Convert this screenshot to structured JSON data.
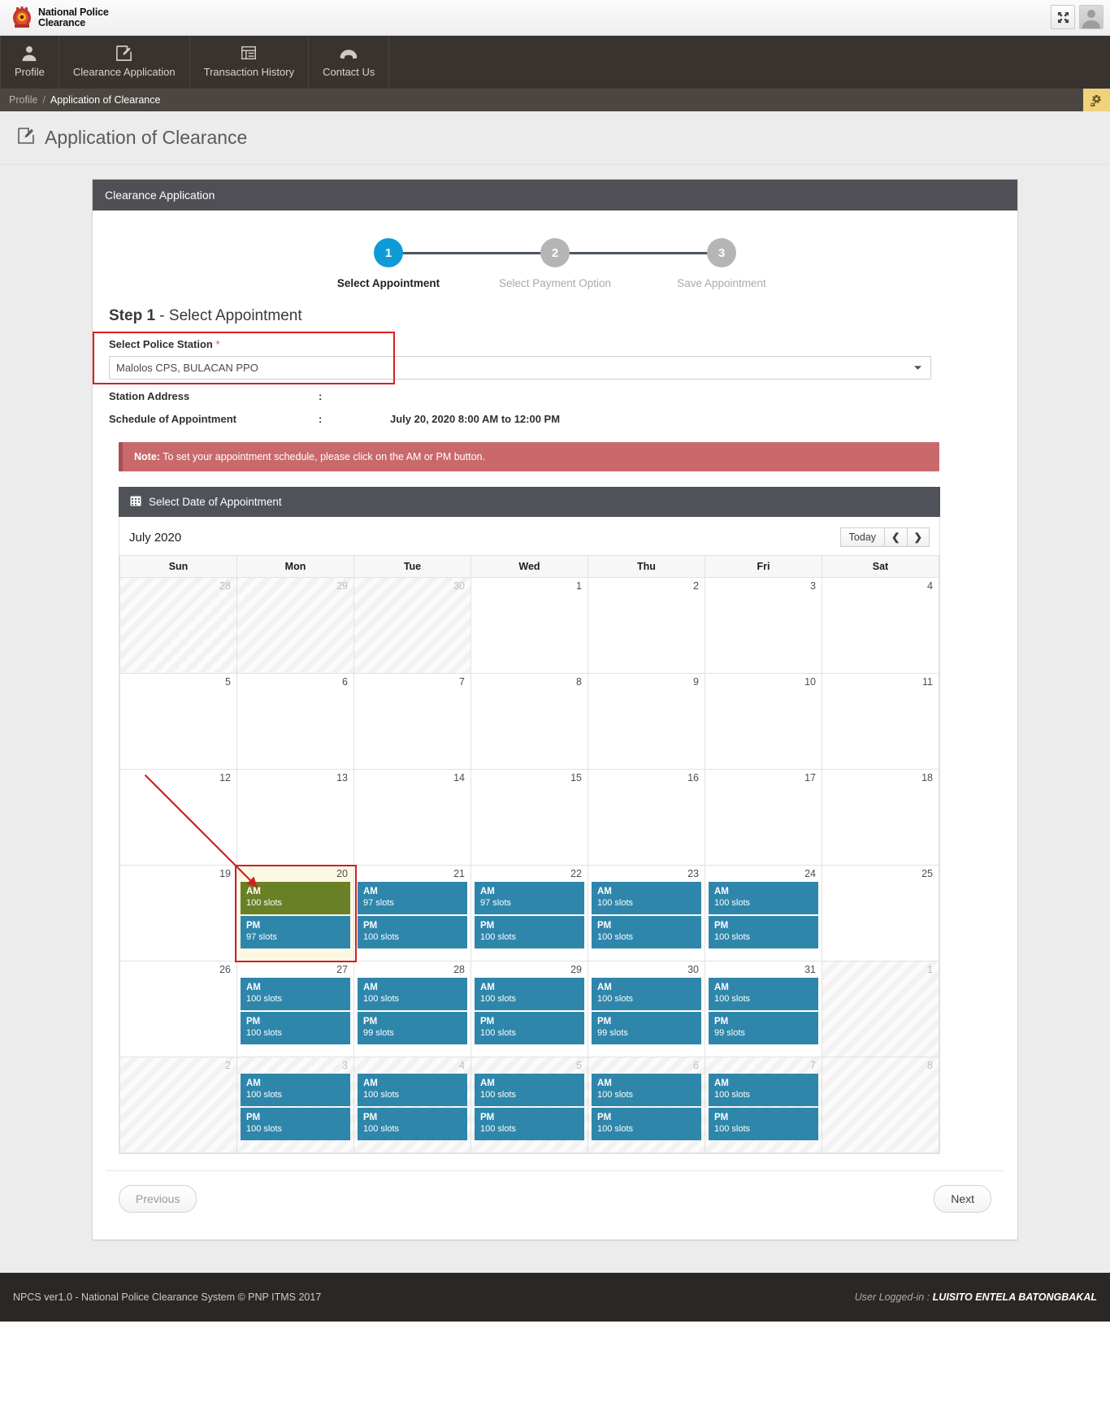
{
  "brand": {
    "line1": "National Police",
    "line2": "Clearance",
    "fullscreen_icon": "expand-icon",
    "avatar_icon": "user-avatar-icon"
  },
  "nav": {
    "items": [
      {
        "label": "Profile",
        "icon": "user-icon"
      },
      {
        "label": "Clearance Application",
        "icon": "edit-document-icon"
      },
      {
        "label": "Transaction History",
        "icon": "list-icon"
      },
      {
        "label": "Contact Us",
        "icon": "phone-icon"
      }
    ]
  },
  "breadcrumb": {
    "parent": "Profile",
    "separator": "/",
    "current": "Application of Clearance",
    "settings_icon": "gears-icon"
  },
  "page": {
    "title": "Application of Clearance",
    "title_icon": "edit-document-icon"
  },
  "panel": {
    "header": "Clearance Application"
  },
  "stepper": {
    "steps": [
      {
        "number": "1",
        "label": "Select Appointment",
        "state": "active"
      },
      {
        "number": "2",
        "label": "Select Payment Option",
        "state": "idle"
      },
      {
        "number": "3",
        "label": "Save Appointment",
        "state": "idle"
      }
    ]
  },
  "step_title": {
    "bold": "Step 1",
    "rest": " - Select Appointment"
  },
  "form": {
    "station_label": "Select Police Station",
    "required_mark": "*",
    "station_value": "Malolos CPS, BULACAN PPO",
    "caret_icon": "chevron-down-icon",
    "station_address_label": "Station Address",
    "station_address_value": "",
    "schedule_label": "Schedule of Appointment",
    "schedule_value": "July 20, 2020 8:00 AM to 12:00 PM",
    "colon": ":"
  },
  "note": {
    "bold": "Note:",
    "text": " To set your appointment schedule, please click on the AM or PM button."
  },
  "calendar": {
    "header": "Select Date of Appointment",
    "header_icon": "calendar-icon",
    "month_label": "July 2020",
    "today_button": "Today",
    "prev_icon": "chevron-left-icon",
    "next_icon": "chevron-right-icon",
    "weekdays": [
      "Sun",
      "Mon",
      "Tue",
      "Wed",
      "Thu",
      "Fri",
      "Sat"
    ],
    "weeks": [
      [
        {
          "day": "28",
          "other": true,
          "slots": []
        },
        {
          "day": "29",
          "other": true,
          "slots": []
        },
        {
          "day": "30",
          "other": true,
          "slots": []
        },
        {
          "day": "1",
          "other": false,
          "slots": []
        },
        {
          "day": "2",
          "other": false,
          "slots": []
        },
        {
          "day": "3",
          "other": false,
          "slots": []
        },
        {
          "day": "4",
          "other": false,
          "slots": []
        }
      ],
      [
        {
          "day": "5",
          "other": false,
          "slots": []
        },
        {
          "day": "6",
          "other": false,
          "slots": []
        },
        {
          "day": "7",
          "other": false,
          "slots": []
        },
        {
          "day": "8",
          "other": false,
          "slots": []
        },
        {
          "day": "9",
          "other": false,
          "slots": []
        },
        {
          "day": "10",
          "other": false,
          "slots": []
        },
        {
          "day": "11",
          "other": false,
          "slots": []
        }
      ],
      [
        {
          "day": "12",
          "other": false,
          "slots": []
        },
        {
          "day": "13",
          "other": false,
          "slots": []
        },
        {
          "day": "14",
          "other": false,
          "slots": []
        },
        {
          "day": "15",
          "other": false,
          "slots": []
        },
        {
          "day": "16",
          "other": false,
          "slots": []
        },
        {
          "day": "17",
          "other": false,
          "slots": []
        },
        {
          "day": "18",
          "other": false,
          "slots": []
        }
      ],
      [
        {
          "day": "19",
          "other": false,
          "slots": []
        },
        {
          "day": "20",
          "other": false,
          "today": true,
          "slots": [
            {
              "period": "AM",
              "count": "100 slots",
              "selected": true
            },
            {
              "period": "PM",
              "count": "97 slots",
              "selected": false
            }
          ]
        },
        {
          "day": "21",
          "other": false,
          "slots": [
            {
              "period": "AM",
              "count": "97 slots",
              "selected": false
            },
            {
              "period": "PM",
              "count": "100 slots",
              "selected": false
            }
          ]
        },
        {
          "day": "22",
          "other": false,
          "slots": [
            {
              "period": "AM",
              "count": "97 slots",
              "selected": false
            },
            {
              "period": "PM",
              "count": "100 slots",
              "selected": false
            }
          ]
        },
        {
          "day": "23",
          "other": false,
          "slots": [
            {
              "period": "AM",
              "count": "100 slots",
              "selected": false
            },
            {
              "period": "PM",
              "count": "100 slots",
              "selected": false
            }
          ]
        },
        {
          "day": "24",
          "other": false,
          "slots": [
            {
              "period": "AM",
              "count": "100 slots",
              "selected": false
            },
            {
              "period": "PM",
              "count": "100 slots",
              "selected": false
            }
          ]
        },
        {
          "day": "25",
          "other": false,
          "slots": []
        }
      ],
      [
        {
          "day": "26",
          "other": false,
          "slots": []
        },
        {
          "day": "27",
          "other": false,
          "slots": [
            {
              "period": "AM",
              "count": "100 slots",
              "selected": false
            },
            {
              "period": "PM",
              "count": "100 slots",
              "selected": false
            }
          ]
        },
        {
          "day": "28",
          "other": false,
          "slots": [
            {
              "period": "AM",
              "count": "100 slots",
              "selected": false
            },
            {
              "period": "PM",
              "count": "99 slots",
              "selected": false
            }
          ]
        },
        {
          "day": "29",
          "other": false,
          "slots": [
            {
              "period": "AM",
              "count": "100 slots",
              "selected": false
            },
            {
              "period": "PM",
              "count": "100 slots",
              "selected": false
            }
          ]
        },
        {
          "day": "30",
          "other": false,
          "slots": [
            {
              "period": "AM",
              "count": "100 slots",
              "selected": false
            },
            {
              "period": "PM",
              "count": "99 slots",
              "selected": false
            }
          ]
        },
        {
          "day": "31",
          "other": false,
          "slots": [
            {
              "period": "AM",
              "count": "100 slots",
              "selected": false
            },
            {
              "period": "PM",
              "count": "99 slots",
              "selected": false
            }
          ]
        },
        {
          "day": "1",
          "other": true,
          "slots": []
        }
      ],
      [
        {
          "day": "2",
          "other": true,
          "slots": []
        },
        {
          "day": "3",
          "other": true,
          "slots": [
            {
              "period": "AM",
              "count": "100 slots",
              "selected": false
            },
            {
              "period": "PM",
              "count": "100 slots",
              "selected": false
            }
          ]
        },
        {
          "day": "4",
          "other": true,
          "slots": [
            {
              "period": "AM",
              "count": "100 slots",
              "selected": false
            },
            {
              "period": "PM",
              "count": "100 slots",
              "selected": false
            }
          ]
        },
        {
          "day": "5",
          "other": true,
          "slots": [
            {
              "period": "AM",
              "count": "100 slots",
              "selected": false
            },
            {
              "period": "PM",
              "count": "100 slots",
              "selected": false
            }
          ]
        },
        {
          "day": "6",
          "other": true,
          "slots": [
            {
              "period": "AM",
              "count": "100 slots",
              "selected": false
            },
            {
              "period": "PM",
              "count": "100 slots",
              "selected": false
            }
          ]
        },
        {
          "day": "7",
          "other": true,
          "slots": [
            {
              "period": "AM",
              "count": "100 slots",
              "selected": false
            },
            {
              "period": "PM",
              "count": "100 slots",
              "selected": false
            }
          ]
        },
        {
          "day": "8",
          "other": true,
          "slots": []
        }
      ]
    ]
  },
  "wizard_buttons": {
    "previous": "Previous",
    "next": "Next"
  },
  "footer": {
    "copyright": "NPCS ver1.0 - National Police Clearance System © PNP ITMS 2017",
    "user_prefix": "User Logged-in : ",
    "user_name": "LUISITO ENTELA BATONGBAKAL"
  },
  "colors": {
    "accent_blue": "#0f9bd7",
    "slot_blue": "#2e86ab",
    "slot_selected_green": "#6a8026",
    "note_red": "#c9696c",
    "annotation_red": "#cf2020",
    "header_dark": "#4f4f55",
    "nav_dark": "#38332f"
  }
}
